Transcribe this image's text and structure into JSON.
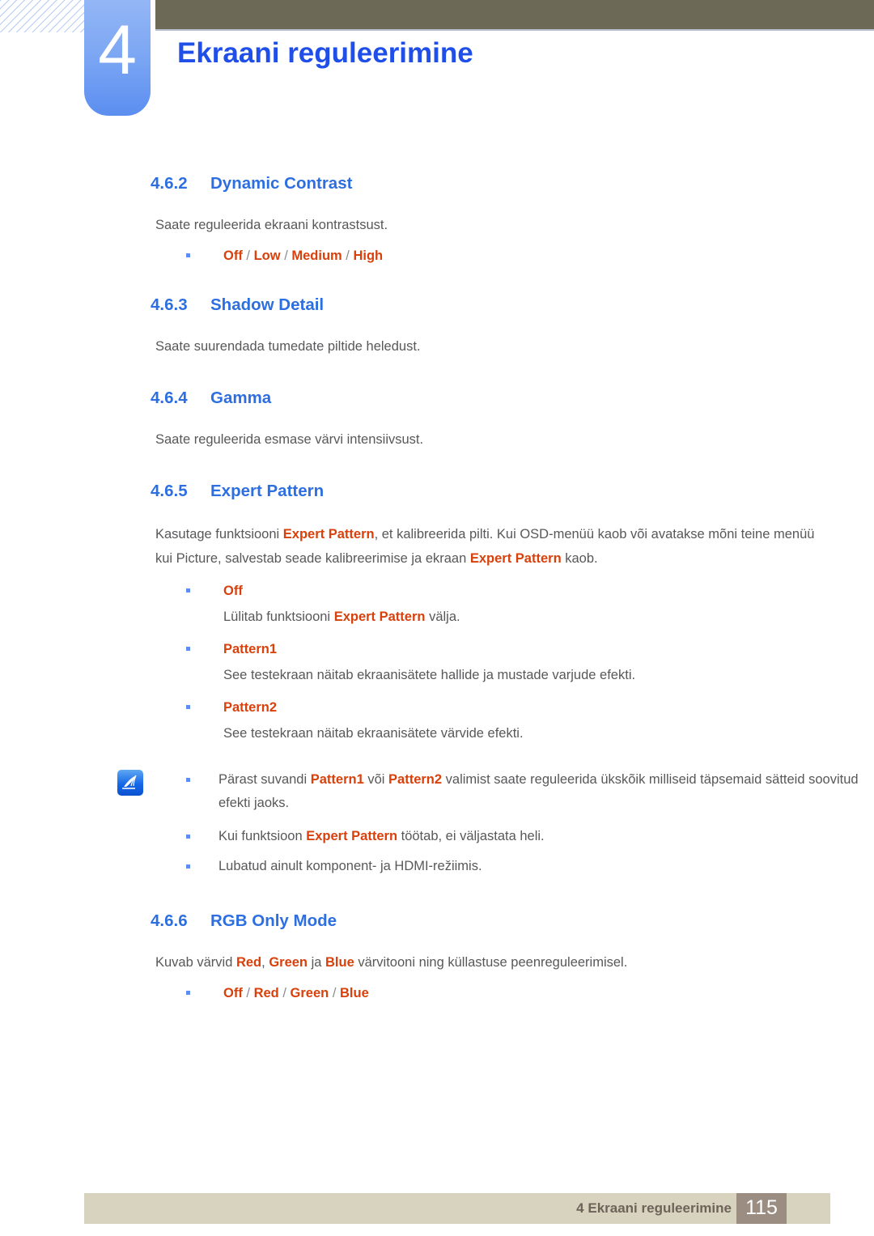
{
  "header": {
    "chapter_number": "4",
    "chapter_title": "Ekraani reguleerimine",
    "bar_color": "#6c6a56",
    "tab_color": "#5b8ef0",
    "title_color": "#1f4ee8"
  },
  "colors": {
    "heading_blue": "#2d6fe0",
    "keyword_orange": "#d8400c",
    "body_gray": "#58585a",
    "bullet_blue": "#5b8ef0",
    "footer_bg": "#d8d3be",
    "footer_pagebox": "#9c8d83"
  },
  "sections": {
    "dynamic_contrast": {
      "number": "4.6.2",
      "title": "Dynamic Contrast",
      "body": "Saate reguleerida ekraani kontrastsust.",
      "options": [
        "Off",
        "Low",
        "Medium",
        "High"
      ],
      "separator": "/"
    },
    "shadow_detail": {
      "number": "4.6.3",
      "title": "Shadow Detail",
      "body": "Saate suurendada tumedate piltide heledust."
    },
    "gamma": {
      "number": "4.6.4",
      "title": "Gamma",
      "body": "Saate reguleerida esmase värvi intensiivsust."
    },
    "expert_pattern": {
      "number": "4.6.5",
      "title": "Expert Pattern",
      "intro_part1": "Kasutage funktsiooni ",
      "intro_kw1": "Expert Pattern",
      "intro_part2": ", et kalibreerida pilti. Kui OSD-menüü kaob või avatakse mõni teine menüü kui Picture, salvestab seade kalibreerimise ja ekraan ",
      "intro_kw2": "Expert Pattern",
      "intro_part3": " kaob.",
      "items": [
        {
          "label": "Off",
          "desc_part1": "Lülitab funktsiooni ",
          "desc_kw": "Expert Pattern",
          "desc_part2": " välja."
        },
        {
          "label": "Pattern1",
          "desc_part1": "See testekraan näitab ekraanisätete hallide ja mustade varjude efekti.",
          "desc_kw": "",
          "desc_part2": ""
        },
        {
          "label": "Pattern2",
          "desc_part1": "See testekraan näitab ekraanisätete värvide efekti.",
          "desc_kw": "",
          "desc_part2": ""
        }
      ],
      "notes": [
        {
          "part1": "Pärast suvandi ",
          "kw1": "Pattern1",
          "part2": " või ",
          "kw2": "Pattern2",
          "part3": " valimist saate reguleerida ükskõik milliseid täpsemaid sätteid soovitud efekti jaoks."
        },
        {
          "part1": "Kui funktsioon ",
          "kw1": "Expert Pattern",
          "part2": " töötab, ei väljastata heli.",
          "kw2": "",
          "part3": ""
        },
        {
          "part1": "Lubatud ainult komponent- ja HDMI-režiimis.",
          "kw1": "",
          "part2": "",
          "kw2": "",
          "part3": ""
        }
      ],
      "note_icon": "note-pen-icon"
    },
    "rgb_only_mode": {
      "number": "4.6.6",
      "title": "RGB Only Mode",
      "body_part1": "Kuvab värvid ",
      "body_kw1": "Red",
      "body_part2": ", ",
      "body_kw2": "Green",
      "body_part3": " ja ",
      "body_kw3": "Blue",
      "body_part4": " värvitooni ning küllastuse peenreguleerimisel.",
      "options": [
        "Off",
        "Red",
        "Green",
        "Blue"
      ],
      "separator": "/"
    }
  },
  "footer": {
    "label": "4 Ekraani reguleerimine",
    "page_number": "115"
  }
}
